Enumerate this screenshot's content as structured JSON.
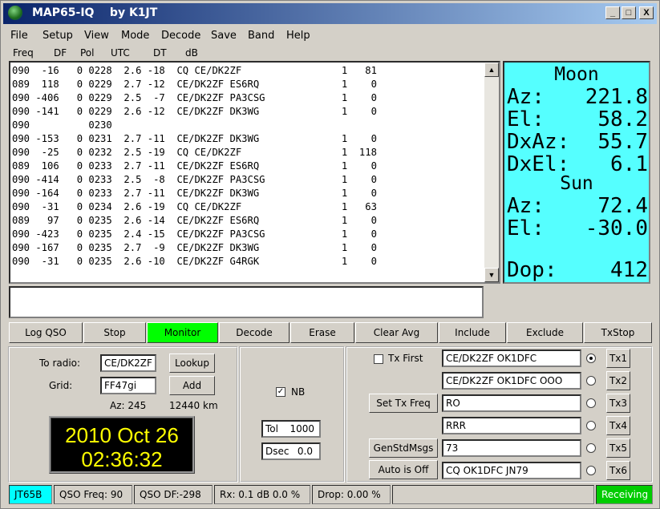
{
  "window": {
    "title": "MAP65-IQ    by K1JT",
    "minimize": "_",
    "maximize": "□",
    "close": "X"
  },
  "menu": [
    "File",
    "Setup",
    "View",
    "Mode",
    "Decode",
    "Save",
    "Band",
    "Help"
  ],
  "columns": [
    "Freq",
    "DF",
    "Pol",
    "UTC",
    "DT",
    "dB"
  ],
  "decodes": [
    "090  -16   0 0228  2.6 -18  CQ CE/DK2ZF                 1   81",
    "089  118   0 0229  2.7 -12  CE/DK2ZF ES6RQ              1    0",
    "090 -406   0 0229  2.5  -7  CE/DK2ZF PA3CSG             1    0",
    "090 -141   0 0229  2.6 -12  CE/DK2ZF DK3WG              1    0",
    "090          0230",
    "090 -153   0 0231  2.7 -11  CE/DK2ZF DK3WG              1    0",
    "090  -25   0 0232  2.5 -19  CQ CE/DK2ZF                 1  118",
    "089  106   0 0233  2.7 -11  CE/DK2ZF ES6RQ              1    0",
    "090 -414   0 0233  2.5  -8  CE/DK2ZF PA3CSG             1    0",
    "090 -164   0 0233  2.7 -11  CE/DK2ZF DK3WG              1    0",
    "090  -31   0 0234  2.6 -19  CQ CE/DK2ZF                 1   63",
    "089   97   0 0235  2.6 -14  CE/DK2ZF ES6RQ              1    0",
    "090 -423   0 0235  2.4 -15  CE/DK2ZF PA3CSG             1    0",
    "090 -167   0 0235  2.7  -9  CE/DK2ZF DK3WG              1    0",
    "090  -31   0 0235  2.6 -10  CE/DK2ZF G4RGK              1    0"
  ],
  "astro": {
    "moon_title": "Moon",
    "moon_az_label": "Az:",
    "moon_az": "221.8",
    "moon_el_label": "El:",
    "moon_el": "58.2",
    "dxaz_label": "DxAz:",
    "dxaz": "55.7",
    "dxel_label": "DxEl:",
    "dxel": "6.1",
    "sun_title": "Sun",
    "sun_az_label": "Az:",
    "sun_az": "72.4",
    "sun_el_label": "El:",
    "sun_el": "-30.0",
    "dop_label": "Dop:",
    "dop": "412"
  },
  "buttons": {
    "log_qso": "Log QSO",
    "stop": "Stop",
    "monitor": "Monitor",
    "decode": "Decode",
    "erase": "Erase",
    "clear_avg": "Clear Avg",
    "include": "Include",
    "exclude": "Exclude",
    "txstop": "TxStop"
  },
  "left": {
    "to_radio_label": "To radio:",
    "to_radio": "CE/DK2ZF",
    "grid_label": "Grid:",
    "grid": "FF47gi",
    "lookup": "Lookup",
    "add": "Add",
    "az": "Az: 245",
    "dist": "12440 km",
    "date": "2010 Oct 26",
    "time": "02:36:32"
  },
  "middle": {
    "nb_label": "NB",
    "nb_checked": true,
    "tol_label": "Tol",
    "tol": "1000",
    "dsec_label": "Dsec",
    "dsec": "0.0"
  },
  "tx": {
    "tx_first_label": "Tx First",
    "set_tx_freq": "Set Tx Freq",
    "gen_std_msgs": "GenStdMsgs",
    "auto": "Auto is Off",
    "messages": [
      {
        "text": "CE/DK2ZF OK1DFC",
        "button": "Tx1",
        "selected": true
      },
      {
        "text": "CE/DK2ZF OK1DFC OOO",
        "button": "Tx2",
        "selected": false
      },
      {
        "text": "RO",
        "button": "Tx3",
        "selected": false
      },
      {
        "text": "RRR",
        "button": "Tx4",
        "selected": false
      },
      {
        "text": "73",
        "button": "Tx5",
        "selected": false
      },
      {
        "text": "CQ OK1DFC JN79",
        "button": "Tx6",
        "selected": false
      }
    ]
  },
  "status": {
    "mode": "JT65B",
    "qso_freq": "QSO Freq:  90",
    "qso_df": "QSO DF:-298",
    "rx": "Rx: 0.1 dB  0.0 %",
    "drop": "Drop: 0.00 %",
    "state": "Receiving"
  },
  "colors": {
    "monitor_on": "#00ff00",
    "astro_bg": "#55ffff",
    "mode_bg": "#00ffff",
    "clock_fg": "#ffff00"
  }
}
